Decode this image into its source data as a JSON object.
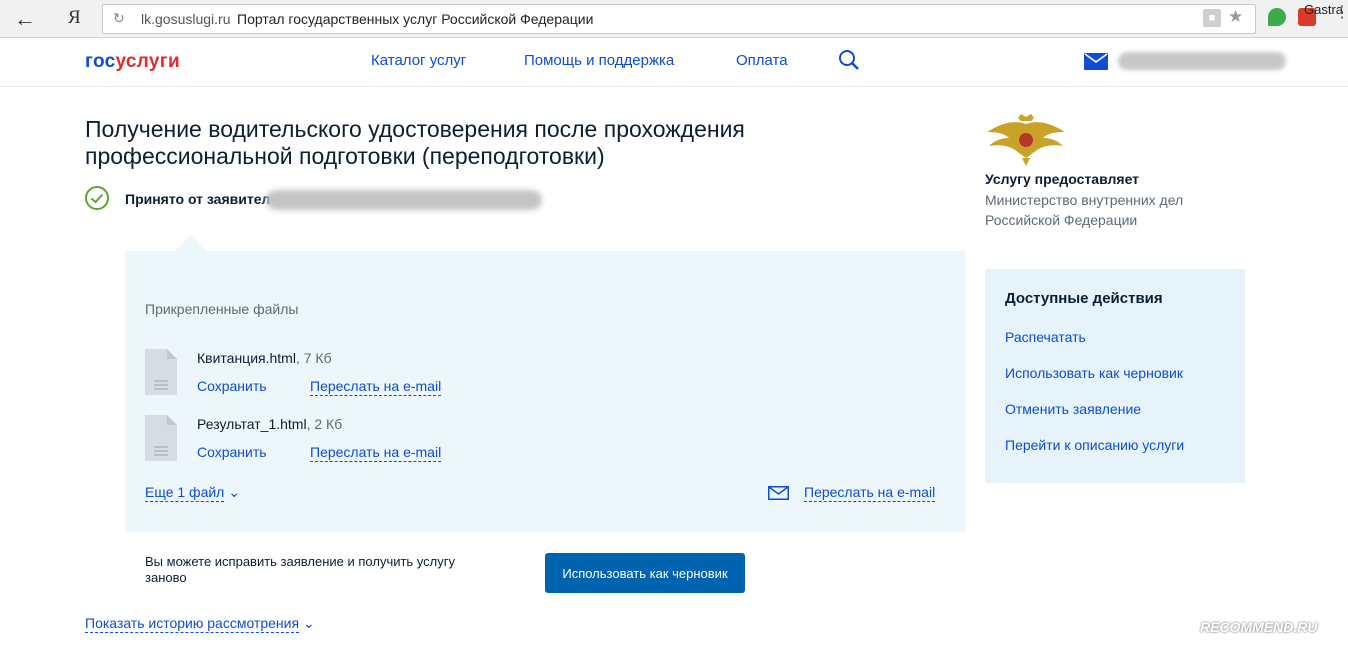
{
  "browser": {
    "host": "lk.gosuslugi.ru",
    "page_title": "Портал государственных услуг Российской Федерации",
    "yandex_label": "Я",
    "extension_label": "Gastra"
  },
  "header": {
    "logo_part1": "гос",
    "logo_part2": "услуги",
    "nav": [
      "Каталог услуг",
      "Помощь и поддержка",
      "Оплата"
    ]
  },
  "main": {
    "title": "Получение водительского удостоверения после прохождения профессиональной подготовки (переподготовки)",
    "status": "Принято от заявител",
    "files_label": "Прикрепленные файлы",
    "files": [
      {
        "name": "Квитанция.html",
        "size": ", 7 Кб",
        "save": "Сохранить",
        "forward": "Переслать на e-mail"
      },
      {
        "name": "Результат_1.html",
        "size": ", 2 Кб",
        "save": "Сохранить",
        "forward": "Переслать на e-mail"
      }
    ],
    "more_files": "Еще 1 файл",
    "forward_all": "Переслать на e-mail",
    "hint": "Вы можете исправить заявление и получить услугу заново",
    "draft_button": "Использовать как черновик",
    "history": "Показать историю рассмотрения"
  },
  "provider": {
    "heading": "Услугу предоставляет",
    "name": "Министерство внутренних дел Российской Федерации"
  },
  "actions": {
    "heading": "Доступные действия",
    "items": [
      "Распечатать",
      "Использовать как черновик",
      "Отменить заявление",
      "Перейти к описанию услуги"
    ]
  },
  "watermark": "RECOMMEND.RU",
  "colors": {
    "link": "#0d4cd3",
    "primary_button": "#0063b0",
    "panel": "#edf6fb",
    "check": "#5aa728"
  }
}
